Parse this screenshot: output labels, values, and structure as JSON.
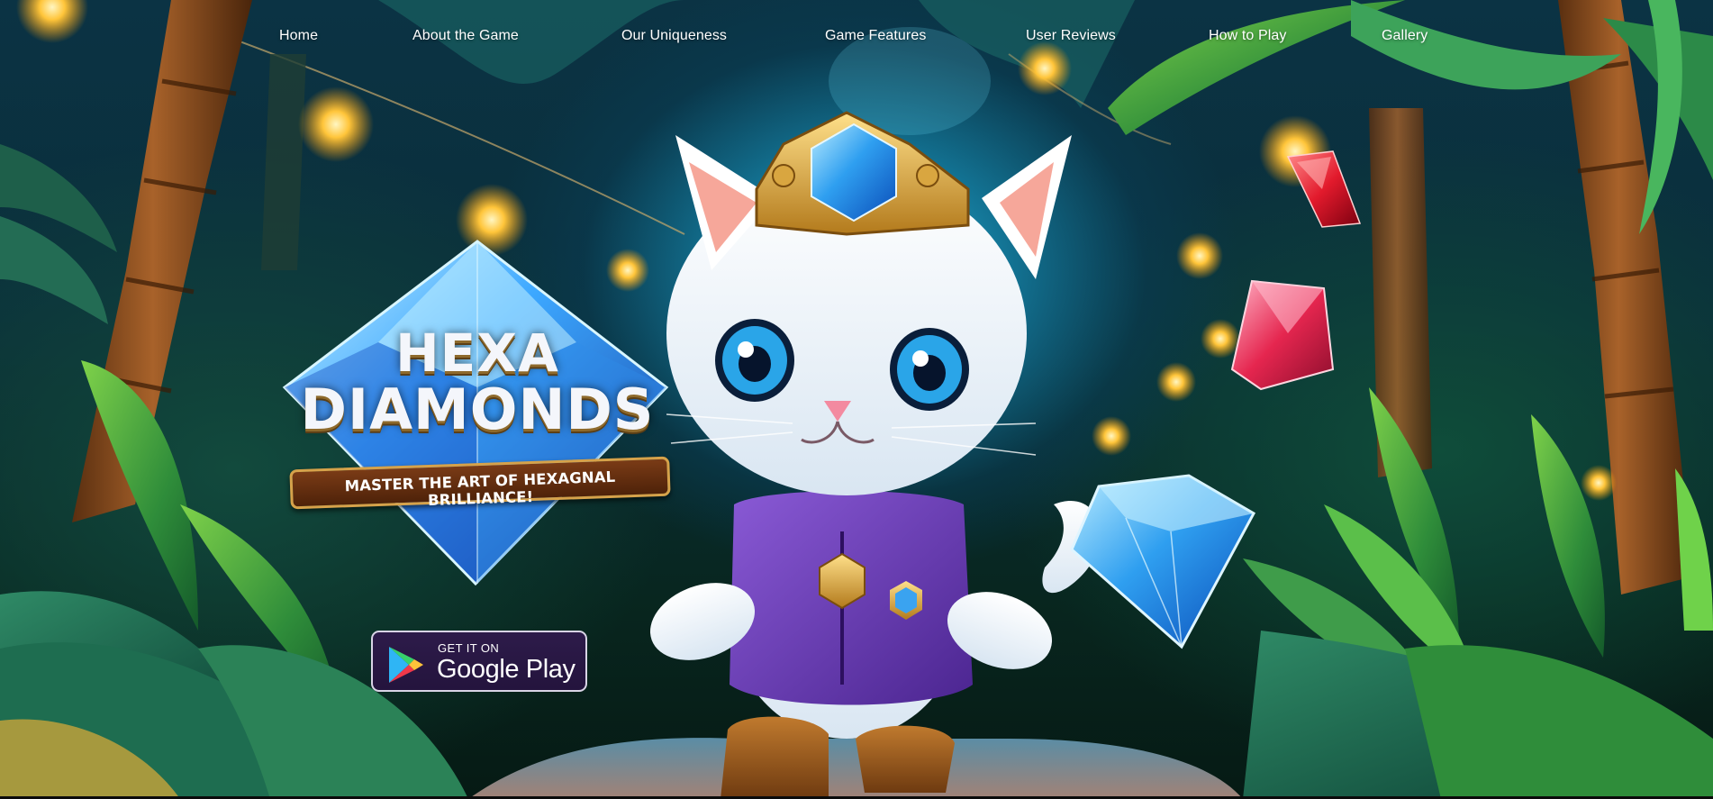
{
  "nav": {
    "items": [
      {
        "label": "Home"
      },
      {
        "label": "About the Game"
      },
      {
        "label": "Our Uniqueness"
      },
      {
        "label": "Game Features"
      },
      {
        "label": "User Reviews"
      },
      {
        "label": "How to Play"
      },
      {
        "label": "Gallery"
      }
    ]
  },
  "hero": {
    "logo": {
      "line1": "HEXA",
      "line2": "DIAMONDS",
      "tagline": "MASTER THE ART OF HEXAGNAL BRILLIANCE!"
    },
    "store_badge": {
      "small_text": "GET IT ON",
      "store_name": "Google Play"
    },
    "icons": {
      "store": "google-play-icon",
      "mascot": "kitten-mascot",
      "gems": [
        "red-gem",
        "pink-gem",
        "blue-diamond"
      ]
    }
  },
  "colors": {
    "nav_text": "#ffffff",
    "badge_bg": "#2d1b4a",
    "badge_border": "#d9d4e6",
    "logo_gold": "#d6a24a",
    "mascot_vest": "#6a3bb0",
    "diamond_blue": "#2f8de8"
  }
}
